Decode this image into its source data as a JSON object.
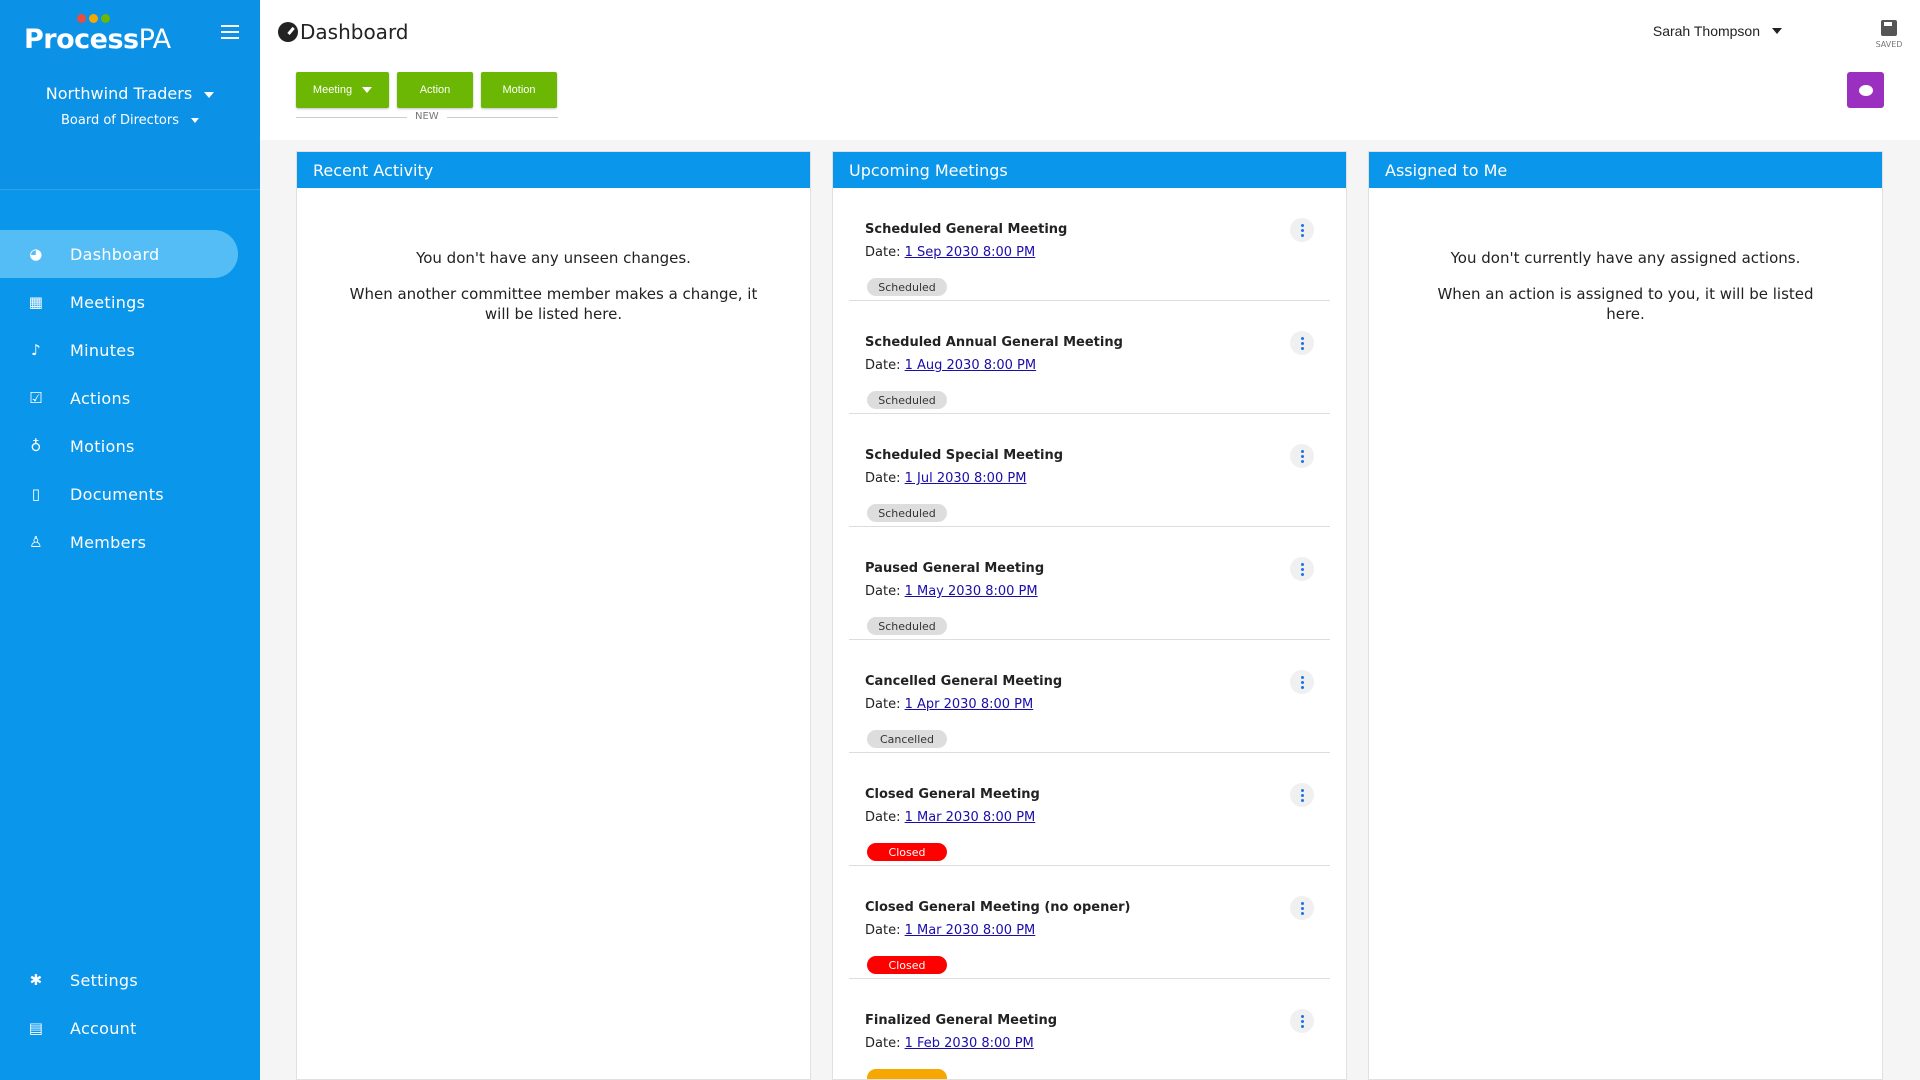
{
  "app": {
    "logo_main": "Process",
    "logo_accent": "PA",
    "logo_dot_colors": [
      "#e94e3c",
      "#f6a800",
      "#6bb704"
    ],
    "accent": "#0a96ea",
    "green": "#6bb704",
    "purple": "#9b2fbf"
  },
  "sidebar": {
    "org_name": "Northwind Traders",
    "committee": "Board of Directors",
    "nav": [
      {
        "label": "Dashboard",
        "icon": "dashboard-icon",
        "active": true
      },
      {
        "label": "Meetings",
        "icon": "calendar-icon"
      },
      {
        "label": "Minutes",
        "icon": "microphone-icon"
      },
      {
        "label": "Actions",
        "icon": "checkbox-icon"
      },
      {
        "label": "Motions",
        "icon": "lightbulb-icon"
      },
      {
        "label": "Documents",
        "icon": "document-icon"
      },
      {
        "label": "Members",
        "icon": "user-icon"
      }
    ],
    "bottom_nav": [
      {
        "label": "Settings",
        "icon": "gear-icon"
      },
      {
        "label": "Account",
        "icon": "id-card-icon"
      }
    ]
  },
  "header": {
    "title": "Dashboard",
    "user_name": "Sarah Thompson",
    "save_label": "SAVED",
    "new_label": "NEW",
    "buttons": {
      "meeting": "Meeting",
      "action": "Action",
      "motion": "Motion"
    }
  },
  "recent_activity": {
    "title": "Recent Activity",
    "line1": "You don't have any unseen changes.",
    "line2": "When another committee member makes a change, it will be listed here."
  },
  "upcoming": {
    "title": "Upcoming Meetings",
    "date_prefix": "Date:",
    "items": [
      {
        "title": "Scheduled General Meeting",
        "date": "1 Sep 2030 8:00 PM",
        "status": "Scheduled",
        "status_color": "grey"
      },
      {
        "title": "Scheduled Annual General Meeting",
        "date": "1 Aug 2030 8:00 PM",
        "status": "Scheduled",
        "status_color": "grey"
      },
      {
        "title": "Scheduled Special Meeting",
        "date": "1 Jul 2030 8:00 PM",
        "status": "Scheduled",
        "status_color": "grey"
      },
      {
        "title": "Paused General Meeting",
        "date": "1 May 2030 8:00 PM",
        "status": "Scheduled",
        "status_color": "grey"
      },
      {
        "title": "Cancelled General Meeting",
        "date": "1 Apr 2030 8:00 PM",
        "status": "Cancelled",
        "status_color": "grey"
      },
      {
        "title": "Closed General Meeting",
        "date": "1 Mar 2030 8:00 PM",
        "status": "Closed",
        "status_color": "red"
      },
      {
        "title": "Closed General Meeting (no opener)",
        "date": "1 Mar 2030 8:00 PM",
        "status": "Closed",
        "status_color": "red"
      },
      {
        "title": "Finalized General Meeting",
        "date": "1 Feb 2030 8:00 PM",
        "status": "",
        "status_color": "yellow"
      }
    ]
  },
  "assigned": {
    "title": "Assigned to Me",
    "line1": "You don't currently have any assigned actions.",
    "line2": "When an action is assigned to you, it will be listed here."
  }
}
